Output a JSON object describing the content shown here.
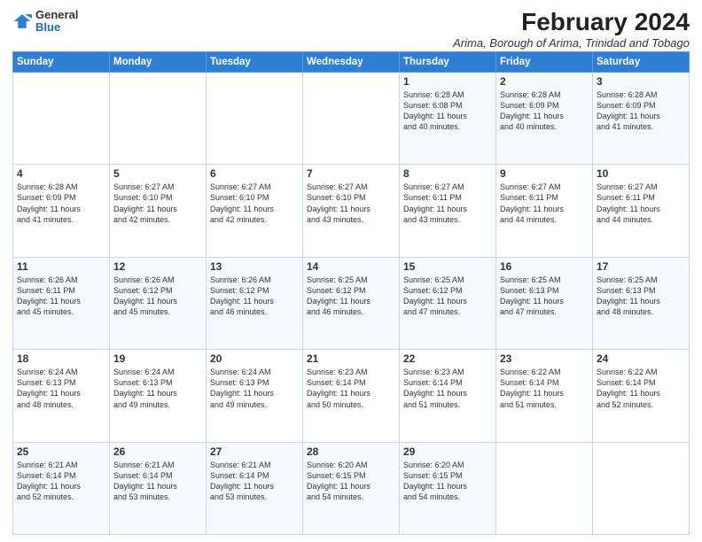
{
  "logo": {
    "general": "General",
    "blue": "Blue"
  },
  "title": "February 2024",
  "subtitle": "Arima, Borough of Arima, Trinidad and Tobago",
  "days_header": [
    "Sunday",
    "Monday",
    "Tuesday",
    "Wednesday",
    "Thursday",
    "Friday",
    "Saturday"
  ],
  "weeks": [
    [
      {
        "day": "",
        "info": ""
      },
      {
        "day": "",
        "info": ""
      },
      {
        "day": "",
        "info": ""
      },
      {
        "day": "",
        "info": ""
      },
      {
        "day": "1",
        "info": "Sunrise: 6:28 AM\nSunset: 6:08 PM\nDaylight: 11 hours\nand 40 minutes."
      },
      {
        "day": "2",
        "info": "Sunrise: 6:28 AM\nSunset: 6:09 PM\nDaylight: 11 hours\nand 40 minutes."
      },
      {
        "day": "3",
        "info": "Sunrise: 6:28 AM\nSunset: 6:09 PM\nDaylight: 11 hours\nand 41 minutes."
      }
    ],
    [
      {
        "day": "4",
        "info": "Sunrise: 6:28 AM\nSunset: 6:09 PM\nDaylight: 11 hours\nand 41 minutes."
      },
      {
        "day": "5",
        "info": "Sunrise: 6:27 AM\nSunset: 6:10 PM\nDaylight: 11 hours\nand 42 minutes."
      },
      {
        "day": "6",
        "info": "Sunrise: 6:27 AM\nSunset: 6:10 PM\nDaylight: 11 hours\nand 42 minutes."
      },
      {
        "day": "7",
        "info": "Sunrise: 6:27 AM\nSunset: 6:10 PM\nDaylight: 11 hours\nand 43 minutes."
      },
      {
        "day": "8",
        "info": "Sunrise: 6:27 AM\nSunset: 6:11 PM\nDaylight: 11 hours\nand 43 minutes."
      },
      {
        "day": "9",
        "info": "Sunrise: 6:27 AM\nSunset: 6:11 PM\nDaylight: 11 hours\nand 44 minutes."
      },
      {
        "day": "10",
        "info": "Sunrise: 6:27 AM\nSunset: 6:11 PM\nDaylight: 11 hours\nand 44 minutes."
      }
    ],
    [
      {
        "day": "11",
        "info": "Sunrise: 6:26 AM\nSunset: 6:11 PM\nDaylight: 11 hours\nand 45 minutes."
      },
      {
        "day": "12",
        "info": "Sunrise: 6:26 AM\nSunset: 6:12 PM\nDaylight: 11 hours\nand 45 minutes."
      },
      {
        "day": "13",
        "info": "Sunrise: 6:26 AM\nSunset: 6:12 PM\nDaylight: 11 hours\nand 46 minutes."
      },
      {
        "day": "14",
        "info": "Sunrise: 6:25 AM\nSunset: 6:12 PM\nDaylight: 11 hours\nand 46 minutes."
      },
      {
        "day": "15",
        "info": "Sunrise: 6:25 AM\nSunset: 6:12 PM\nDaylight: 11 hours\nand 47 minutes."
      },
      {
        "day": "16",
        "info": "Sunrise: 6:25 AM\nSunset: 6:13 PM\nDaylight: 11 hours\nand 47 minutes."
      },
      {
        "day": "17",
        "info": "Sunrise: 6:25 AM\nSunset: 6:13 PM\nDaylight: 11 hours\nand 48 minutes."
      }
    ],
    [
      {
        "day": "18",
        "info": "Sunrise: 6:24 AM\nSunset: 6:13 PM\nDaylight: 11 hours\nand 48 minutes."
      },
      {
        "day": "19",
        "info": "Sunrise: 6:24 AM\nSunset: 6:13 PM\nDaylight: 11 hours\nand 49 minutes."
      },
      {
        "day": "20",
        "info": "Sunrise: 6:24 AM\nSunset: 6:13 PM\nDaylight: 11 hours\nand 49 minutes."
      },
      {
        "day": "21",
        "info": "Sunrise: 6:23 AM\nSunset: 6:14 PM\nDaylight: 11 hours\nand 50 minutes."
      },
      {
        "day": "22",
        "info": "Sunrise: 6:23 AM\nSunset: 6:14 PM\nDaylight: 11 hours\nand 51 minutes."
      },
      {
        "day": "23",
        "info": "Sunrise: 6:22 AM\nSunset: 6:14 PM\nDaylight: 11 hours\nand 51 minutes."
      },
      {
        "day": "24",
        "info": "Sunrise: 6:22 AM\nSunset: 6:14 PM\nDaylight: 11 hours\nand 52 minutes."
      }
    ],
    [
      {
        "day": "25",
        "info": "Sunrise: 6:21 AM\nSunset: 6:14 PM\nDaylight: 11 hours\nand 52 minutes."
      },
      {
        "day": "26",
        "info": "Sunrise: 6:21 AM\nSunset: 6:14 PM\nDaylight: 11 hours\nand 53 minutes."
      },
      {
        "day": "27",
        "info": "Sunrise: 6:21 AM\nSunset: 6:14 PM\nDaylight: 11 hours\nand 53 minutes."
      },
      {
        "day": "28",
        "info": "Sunrise: 6:20 AM\nSunset: 6:15 PM\nDaylight: 11 hours\nand 54 minutes."
      },
      {
        "day": "29",
        "info": "Sunrise: 6:20 AM\nSunset: 6:15 PM\nDaylight: 11 hours\nand 54 minutes."
      },
      {
        "day": "",
        "info": ""
      },
      {
        "day": "",
        "info": ""
      }
    ]
  ]
}
